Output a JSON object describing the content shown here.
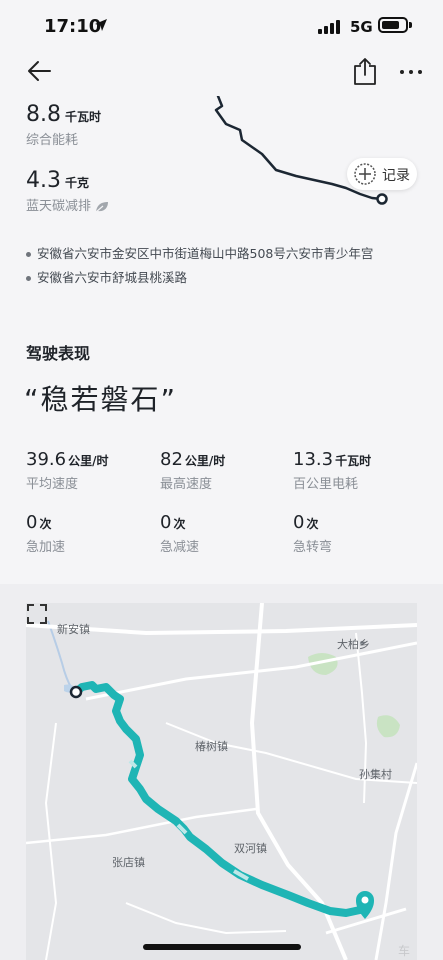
{
  "status_bar": {
    "time": "17:10",
    "network": "5G"
  },
  "summary": {
    "energy_value": "8.8",
    "energy_unit": "千瓦时",
    "energy_label": "综合能耗",
    "carbon_value": "4.3",
    "carbon_unit": "千克",
    "carbon_label": "蓝天碳减排"
  },
  "record_button": {
    "label": "记录"
  },
  "addresses": [
    "安徽省六安市金安区中市街道梅山中路508号六安市青少年宫",
    "安徽省六安市舒城县桃溪路"
  ],
  "driving": {
    "title": "驾驶表现",
    "quote": "“稳若磐石”",
    "stats": [
      {
        "value": "39.6",
        "unit": "公里/时",
        "label": "平均速度"
      },
      {
        "value": "82",
        "unit": "公里/时",
        "label": "最高速度"
      },
      {
        "value": "13.3",
        "unit": "千瓦时",
        "label": "百公里电耗"
      },
      {
        "value": "0",
        "unit": "次",
        "label": "急加速"
      },
      {
        "value": "0",
        "unit": "次",
        "label": "急减速"
      },
      {
        "value": "0",
        "unit": "次",
        "label": "急转弯"
      }
    ]
  },
  "map": {
    "places": [
      "新安镇",
      "大柏乡",
      "椿树镇",
      "孙集村",
      "双河镇",
      "张店镇"
    ],
    "route_color": "#1fb5b5"
  },
  "watermark": "车"
}
